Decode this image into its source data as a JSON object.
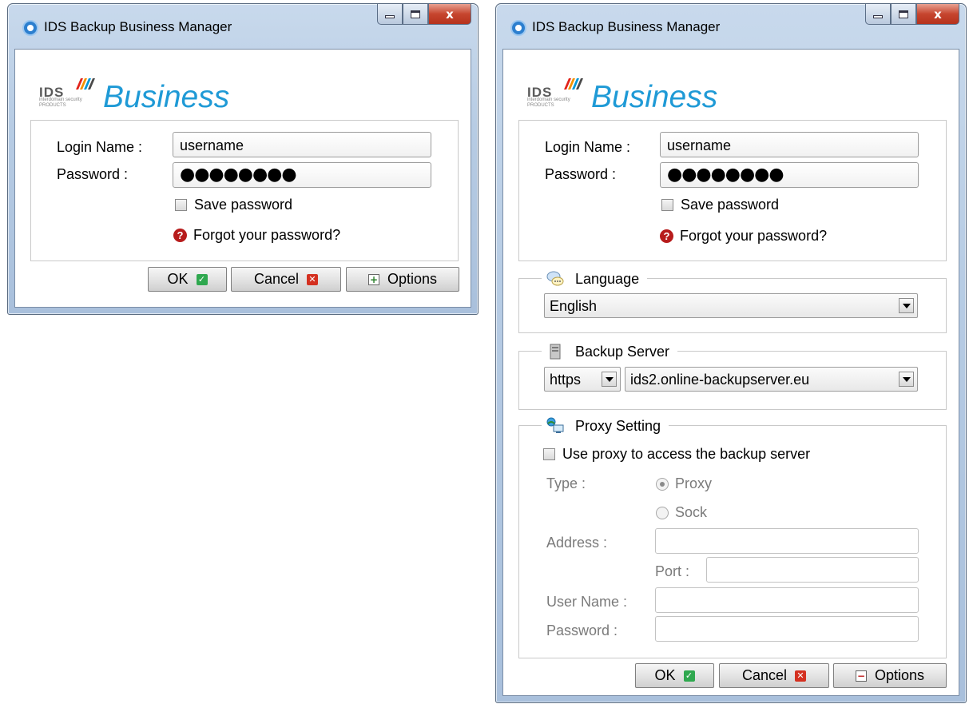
{
  "window_title": "IDS Backup Business Manager",
  "controls": {
    "close_glyph": "x"
  },
  "brand": {
    "name": "Business",
    "ids_text": "IDS",
    "tagline": "interdomain security",
    "products_text": "PRODUCTS"
  },
  "login": {
    "login_name_label": "Login Name :",
    "login_name_value": "username",
    "password_label": "Password :",
    "password_value": "●●●●●●●●",
    "save_password_label": "Save password",
    "forgot_password_link": "Forgot your password?"
  },
  "buttons": {
    "ok": "OK",
    "cancel": "Cancel",
    "options": "Options"
  },
  "language": {
    "heading": "Language",
    "selected": "English"
  },
  "backup_server": {
    "heading": "Backup Server",
    "protocol": "https",
    "host": "ids2.online-backupserver.eu"
  },
  "proxy": {
    "heading": "Proxy Setting",
    "use_proxy_label": "Use proxy to access the backup server",
    "type_label": "Type :",
    "type_options": [
      "Proxy",
      "Sock"
    ],
    "address_label": "Address :",
    "port_label": "Port :",
    "username_label": "User Name :",
    "password_label": "Password :"
  },
  "colors": {
    "brand_blue": "#1f9ad6",
    "titlebar": "#b7cce4",
    "ok_green": "#2fa84f",
    "cancel_red": "#d43020"
  }
}
